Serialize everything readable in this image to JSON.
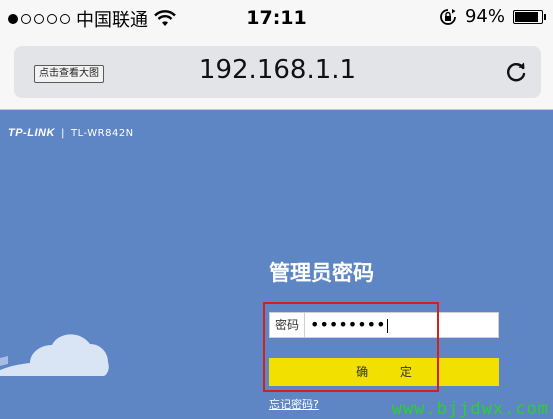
{
  "status_bar": {
    "carrier": "中国联通",
    "time": "17:11",
    "battery_percent": "94%",
    "battery_level": 0.94,
    "signal_bars_filled": 1,
    "signal_bars_total": 5
  },
  "address_bar": {
    "view_large_image_label": "点击查看大图",
    "url": "192.168.1.1"
  },
  "router_page": {
    "brand": "TP-LINK",
    "separator": "|",
    "model": "TL-WR842N",
    "title": "管理员密码",
    "password_label": "密码",
    "password_value": "••••••••",
    "confirm_label": "确 定",
    "forgot_password_link": "忘记密码?"
  },
  "watermark": "www.bjjdwx.com",
  "colors": {
    "page_background": "#5e86c4",
    "confirm_button": "#f2e100",
    "highlight_box": "#d02020",
    "watermark": "#2ad12a"
  }
}
